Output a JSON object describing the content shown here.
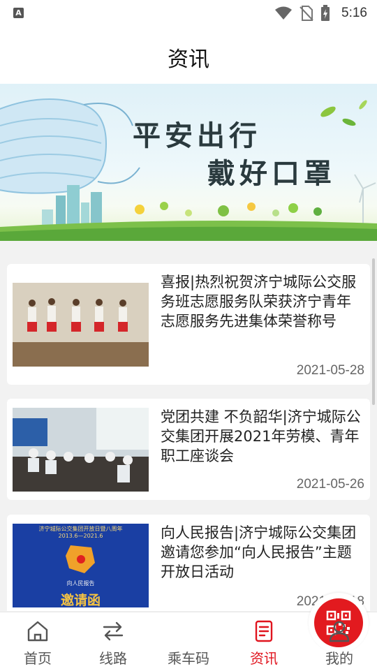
{
  "status_bar": {
    "time": "5:16",
    "left_icon": "A"
  },
  "header": {
    "title": "资讯"
  },
  "banner": {
    "line1": "平安出行",
    "line2": "戴好口罩"
  },
  "articles": [
    {
      "title": "喜报|热烈祝贺济宁城际公交服务班志愿服务队荣获济宁青年志愿服务先进集体荣誉称号",
      "date": "2021-05-28"
    },
    {
      "title": "党团共建 不负韶华|济宁城际公交集团开展2021年劳模、青年职工座谈会",
      "date": "2021-05-26"
    },
    {
      "title": "向人民报告|济宁城际公交集团邀请您参加“向人民报告”主题开放日活动",
      "date": "2021-06-18",
      "thumb_text": {
        "top": "济宁城际公交集团开放日暨八周年",
        "years": "2013.6—2021.6",
        "middle": "向人民报告",
        "bottom": "邀请函"
      }
    }
  ],
  "nav": {
    "items": [
      {
        "label": "首页",
        "icon": "home-icon"
      },
      {
        "label": "线路",
        "icon": "route-icon"
      },
      {
        "label": "乘车码",
        "icon": "qr-code-icon"
      },
      {
        "label": "资讯",
        "icon": "news-icon"
      },
      {
        "label": "我的",
        "icon": "user-icon"
      }
    ],
    "active_index": 3
  },
  "colors": {
    "accent": "#e0141e",
    "background": "#f2f2f2"
  }
}
